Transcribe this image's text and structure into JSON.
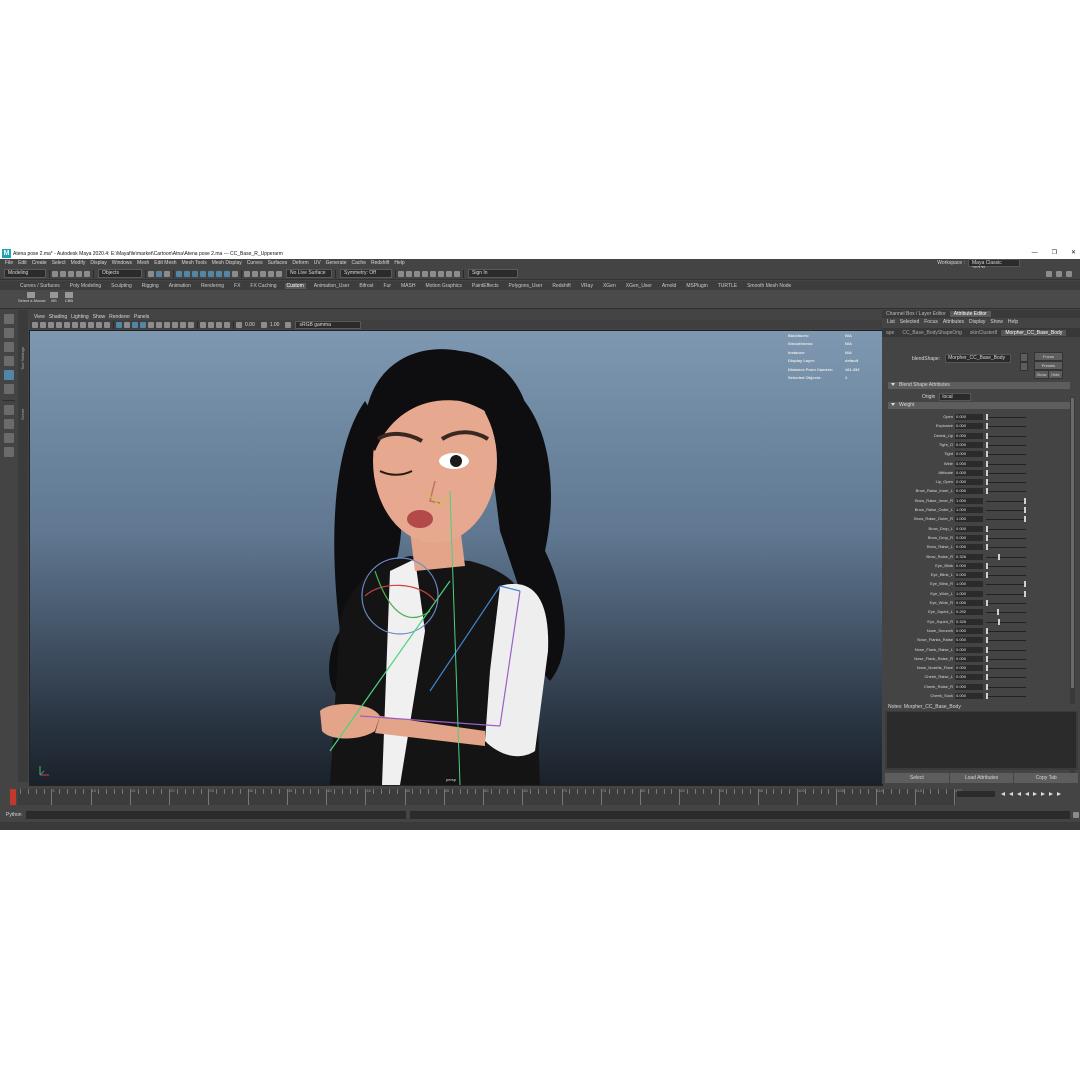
{
  "window": {
    "title": "Atena pose 2.ma* - Autodesk Maya 2020.4: E:\\Mayafile\\market\\Cartoon\\Atna\\Atena pose 2.ma  ---  CC_Base_R_Upperarm",
    "controls": [
      "—",
      "❐",
      "✕"
    ]
  },
  "menubar": {
    "items": [
      "File",
      "Edit",
      "Create",
      "Select",
      "Modify",
      "Display",
      "Windows",
      "Mesh",
      "Edit Mesh",
      "Mesh Tools",
      "Mesh Display",
      "Curves",
      "Surfaces",
      "Deform",
      "UV",
      "Generate",
      "Cache",
      "Redshift",
      "Help"
    ],
    "workspace_label": "Workspace :",
    "workspace_value": "Maya Classic 2022*"
  },
  "statusline": {
    "mode": "Modeling",
    "selection_mode": "Objects",
    "live_surface": "No Live Surface",
    "symmetry": "Symmetry: Off",
    "sign_in": "Sign In"
  },
  "shelf": {
    "tabs": [
      "Curves / Surfaces",
      "Poly Modeling",
      "Sculpting",
      "Rigging",
      "Animation",
      "Rendering",
      "FX",
      "FX Caching",
      "Custom",
      "Animation_User",
      "Bifrost",
      "Fur",
      "MASH",
      "Motion Graphics",
      "PaintEffects",
      "Polygons_User",
      "Redshift",
      "VRay",
      "XGen",
      "XGen_User",
      "Arnold",
      "MSPlugin",
      "TURTLE",
      "Smooth Mesh Node"
    ],
    "active_tab": "Custom",
    "buttons": [
      "Select a Mouse",
      "BS",
      "CBB"
    ]
  },
  "sidebar_tabs": [
    "Tool Settings",
    "Scene"
  ],
  "viewport": {
    "menu": [
      "View",
      "Shading",
      "Lighting",
      "Show",
      "Renderer",
      "Panels"
    ],
    "exposure": "0.00",
    "gamma": "1.00",
    "colorspace": "sRGB gamma",
    "camera": "persp",
    "hud": [
      {
        "label": "Backfaces:",
        "value": "N/A"
      },
      {
        "label": "Smoothness:",
        "value": "N/A"
      },
      {
        "label": "Instance:",
        "value": "N/A"
      },
      {
        "label": "Display Layer:",
        "value": "default"
      },
      {
        "label": "Distance From Camera:",
        "value": "161.332"
      },
      {
        "label": "Selected Objects:",
        "value": "1"
      }
    ]
  },
  "attribute_editor": {
    "panel_tabs": [
      "Channel Box / Layer Editor",
      "Attribute Editor"
    ],
    "active_panel_tab": "Attribute Editor",
    "menu": [
      "List",
      "Selected",
      "Focus",
      "Attributes",
      "Display",
      "Show",
      "Help"
    ],
    "node_tabs": [
      "ape",
      "CC_Base_BodyShapeOrig",
      "skinCluster8",
      "Morpher_CC_Base_Body"
    ],
    "active_node_tab": "Morpher_CC_Base_Body",
    "blendshape_label": "blendShape:",
    "blendshape_value": "Morpher_CC_Base_Body",
    "buttons": {
      "focus": "Focus",
      "presets": "Presets",
      "show": "Show",
      "hide": "Hide"
    },
    "section_blend": "Blend Shape Attributes",
    "origin_label": "Origin",
    "origin_value": "local",
    "section_weight": "Weight",
    "weights": [
      {
        "name": "Open",
        "value": 0
      },
      {
        "name": "Explosive",
        "value": 0
      },
      {
        "name": "Dental_Lip",
        "value": 0
      },
      {
        "name": "Tight_O",
        "value": 0
      },
      {
        "name": "Tight",
        "value": 0
      },
      {
        "name": "Wide",
        "value": 0
      },
      {
        "name": "Affricate",
        "value": 0
      },
      {
        "name": "Lip_Open",
        "value": 0
      },
      {
        "name": "Brow_Raise_Inner_L",
        "value": 0
      },
      {
        "name": "Brow_Raise_Inner_R",
        "value": 1
      },
      {
        "name": "Brow_Raise_Outer_L",
        "value": 1
      },
      {
        "name": "Brow_Raise_Outer_R",
        "value": 1
      },
      {
        "name": "Brow_Drop_L",
        "value": 0
      },
      {
        "name": "Brow_Drop_R",
        "value": 0
      },
      {
        "name": "Brow_Raise_L",
        "value": 0
      },
      {
        "name": "Brow_Raise_R",
        "value": 0.326
      },
      {
        "name": "Eye_Blink",
        "value": 0
      },
      {
        "name": "Eye_Blink_L",
        "value": 0
      },
      {
        "name": "Eye_Blink_R",
        "value": 1
      },
      {
        "name": "Eye_Wide_L",
        "value": 1
      },
      {
        "name": "Eye_Wide_R",
        "value": 0
      },
      {
        "name": "Eye_Squint_L",
        "value": 0.292
      },
      {
        "name": "Eye_Squint_R",
        "value": 0.326
      },
      {
        "name": "Nose_Scrunch",
        "value": 0
      },
      {
        "name": "Nose_Flanks_Raise",
        "value": 0
      },
      {
        "name": "Nose_Flank_Raise_L",
        "value": 0
      },
      {
        "name": "Nose_Flank_Raise_R",
        "value": 0
      },
      {
        "name": "Nose_Nostrils_Flare",
        "value": 0
      },
      {
        "name": "Cheek_Raise_L",
        "value": 0
      },
      {
        "name": "Cheek_Raise_R",
        "value": 0
      },
      {
        "name": "Cheek_Suck",
        "value": 0
      }
    ],
    "notes_label": "Notes:  Morpher_CC_Base_Body",
    "bottom_buttons": [
      "Select",
      "Load Attributes",
      "Copy Tab"
    ]
  },
  "timeline": {
    "current_frame": 1,
    "labels": [
      "5",
      "10",
      "15",
      "20",
      "25",
      "30",
      "35",
      "40",
      "45",
      "50",
      "55",
      "60",
      "65",
      "70",
      "75",
      "80",
      "85",
      "90",
      "95",
      "100",
      "105",
      "110",
      "115",
      "120"
    ]
  },
  "commandline": {
    "language": "Python"
  }
}
